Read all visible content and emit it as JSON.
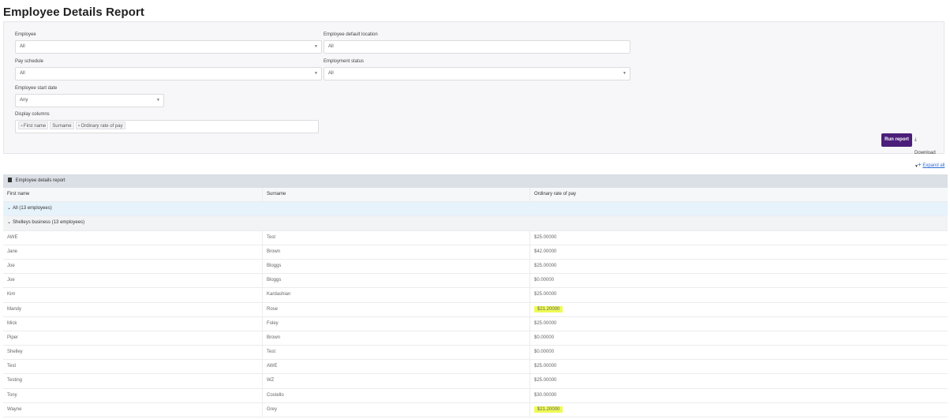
{
  "page": {
    "title": "Employee Details Report"
  },
  "filters": {
    "employee": {
      "label": "Employee",
      "value": "All"
    },
    "default_location": {
      "label": "Employee default location",
      "value": "All"
    },
    "pay_schedule": {
      "label": "Pay schedule",
      "value": "All"
    },
    "employment_status": {
      "label": "Employment status",
      "value": "All"
    },
    "start_date": {
      "label": "Employee start date",
      "value": "Any"
    },
    "display_columns": {
      "label": "Display columns",
      "tags": [
        "First name",
        "Surname",
        "Ordinary rate of pay"
      ]
    }
  },
  "actions": {
    "run": "Run report",
    "download": "Download"
  },
  "expand_all": "Expand all",
  "report": {
    "title": "Employee details report",
    "columns": [
      "First name",
      "Surname",
      "Ordinary rate of pay"
    ],
    "group_all": "All (13 employees)",
    "group_business": "Shelleys business (13 employees)",
    "rows": [
      {
        "first": "AWE",
        "surname": "Test",
        "rate": "$25.00000"
      },
      {
        "first": "Jane",
        "surname": "Brown",
        "rate": "$42.00000"
      },
      {
        "first": "Joe",
        "surname": "Bloggs",
        "rate": "$25.00000"
      },
      {
        "first": "Joe",
        "surname": "Bloggs",
        "rate": "$0.00000"
      },
      {
        "first": "Kim",
        "surname": "Kardashian",
        "rate": "$25.00000"
      },
      {
        "first": "Mandy",
        "surname": "Rose",
        "rate": "$21.20000"
      },
      {
        "first": "Mick",
        "surname": "Foley",
        "rate": "$25.00000"
      },
      {
        "first": "Piper",
        "surname": "Brown",
        "rate": "$0.00000"
      },
      {
        "first": "Shelley",
        "surname": "Test",
        "rate": "$0.00000"
      },
      {
        "first": "Test",
        "surname": "AWE",
        "rate": "$25.00000"
      },
      {
        "first": "Testing",
        "surname": "WZ",
        "rate": "$25.00000"
      },
      {
        "first": "Tony",
        "surname": "Costello",
        "rate": "$30.00000"
      },
      {
        "first": "Wayne",
        "surname": "Grey",
        "rate": "$21.20000"
      }
    ]
  },
  "colors": {
    "run_button": "#4b1e79",
    "highlight": "#eefa55",
    "link": "#2f6fd8"
  }
}
